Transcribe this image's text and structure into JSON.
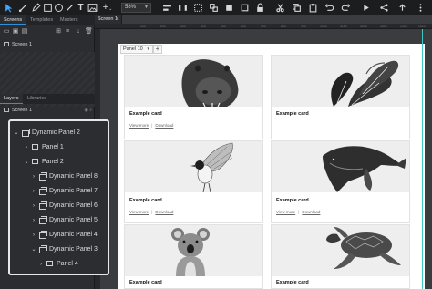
{
  "toolbar": {
    "zoom": "58%"
  },
  "sidebar": {
    "tabs": [
      "Screens",
      "Templates",
      "Masters"
    ],
    "screens": [
      {
        "label": "Screen 1"
      }
    ],
    "layer_tabs": [
      "Layers",
      "Libraries"
    ],
    "layer_screen": "Screen 1"
  },
  "layers_tree": {
    "nodes": [
      {
        "label": "Dynamic Panel 2",
        "kind": "dynamic-panel",
        "expanded": true
      },
      {
        "label": "Panel 1",
        "kind": "panel",
        "expanded": false
      },
      {
        "label": "Panel 2",
        "kind": "panel",
        "expanded": true
      },
      {
        "label": "Dynamic Panel 8",
        "kind": "dynamic-panel",
        "expanded": false
      },
      {
        "label": "Dynamic Panel 7",
        "kind": "dynamic-panel",
        "expanded": false
      },
      {
        "label": "Dynamic Panel 6",
        "kind": "dynamic-panel",
        "expanded": false
      },
      {
        "label": "Dynamic Panel 5",
        "kind": "dynamic-panel",
        "expanded": false
      },
      {
        "label": "Dynamic Panel 4",
        "kind": "dynamic-panel",
        "expanded": false
      },
      {
        "label": "Dynamic Panel 3",
        "kind": "dynamic-panel",
        "expanded": true
      },
      {
        "label": "Panel 4",
        "kind": "panel",
        "expanded": false
      }
    ]
  },
  "canvas": {
    "tab_label": "Screen 1",
    "panel_select": "Panel 10",
    "panel_add": "+",
    "ruler_marks": [
      "100",
      "200",
      "300",
      "400",
      "500",
      "600",
      "700",
      "800",
      "900",
      "1000",
      "1100",
      "1200",
      "1300",
      "1400",
      "1500"
    ],
    "cards": [
      {
        "title": "Example card",
        "link1": "View more",
        "link2": "Download",
        "image": "hippo-photo",
        "has_links": true
      },
      {
        "title": "Example card",
        "link1": "",
        "link2": "",
        "image": "plant-leaves-photo",
        "has_links": false
      },
      {
        "title": "Example card",
        "link1": "View more",
        "link2": "Download",
        "image": "bird-photo",
        "has_links": true
      },
      {
        "title": "Example card",
        "link1": "View more",
        "link2": "Download",
        "image": "whale-photo",
        "has_links": true
      },
      {
        "title": "Example card",
        "link1": "",
        "link2": "",
        "image": "koala-photo",
        "has_links": false
      },
      {
        "title": "Example card",
        "link1": "",
        "link2": "",
        "image": "sea-turtle-photo",
        "has_links": false
      }
    ]
  },
  "colors": {
    "guide": "#3dc9c0",
    "accent": "#2f8fd8",
    "highlight_border": "#e8e8e8"
  }
}
